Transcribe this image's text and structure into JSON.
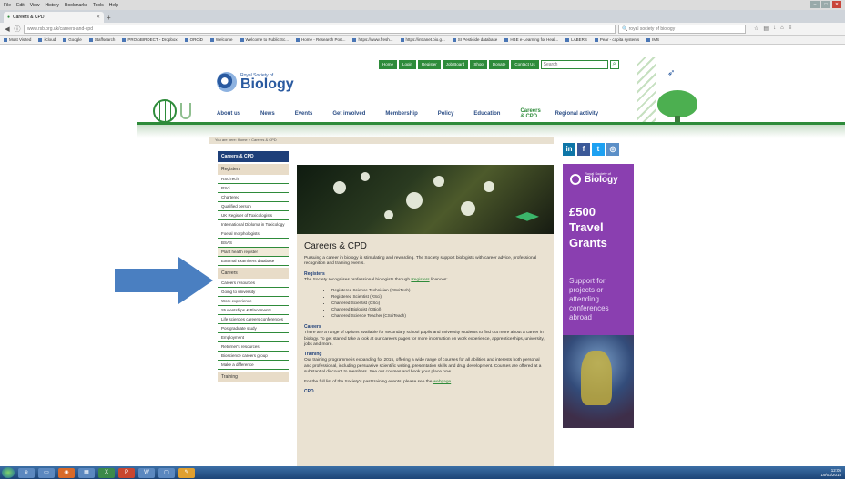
{
  "browser": {
    "menu": [
      "File",
      "Edit",
      "View",
      "History",
      "Bookmarks",
      "Tools",
      "Help"
    ],
    "tab_title": "Careers & CPD",
    "url": "www.rsb.org.uk/careers-and-cpd",
    "search": "royal society of biology",
    "bookmarks": [
      "Most Visited",
      "iCloud",
      "Google",
      "Staffsearch",
      "PROtoBIRDECT - Dropbox",
      "ORCiD",
      "Welcome",
      "Welcome to Public Sc...",
      "Home - Research Port...",
      "https://www.fresh...",
      "https://intranet.bio.g...",
      "SI Pesticide database",
      "HBE e-Learning for Heal...",
      "LABERS",
      "Pear - capita systems",
      "IMS"
    ]
  },
  "site": {
    "top_buttons": [
      "Home",
      "Login",
      "Register",
      "Job Board",
      "Shop",
      "Donate",
      "Contact Us"
    ],
    "search_placeholder": "Search",
    "logo_small": "Royal Society of",
    "logo_big": "Biology",
    "nav": [
      "About us",
      "News",
      "Events",
      "Get involved",
      "Membership",
      "Policy",
      "Education",
      "Careers & CPD",
      "Regional activity"
    ],
    "breadcrumb": "You are here:   Home  »  Careers & CPD"
  },
  "sidebar": {
    "header": "Careers & CPD",
    "sections": [
      {
        "title": "Registers",
        "items": [
          "RSciTech",
          "RSci",
          "Chartered",
          "Qualified person",
          "UK Register of Toxicologists",
          "International Diploma in Toxicology",
          "Foetal morphologists",
          "BSAS",
          "Plant health register",
          "External examiners database"
        ]
      },
      {
        "title": "Careers",
        "items": [
          "Careers resources",
          "Going to university",
          "Work experience",
          "Studentships & Placements",
          "Life sciences careers conferences",
          "Postgraduate study",
          "Employment",
          "Returner's resources",
          "Bioscience careers group",
          "Make a difference"
        ]
      },
      {
        "title": "Training",
        "items": []
      }
    ]
  },
  "content": {
    "title": "Careers & CPD",
    "intro": "Pursuing a career in biology is stimulating and rewarding. The Society support biologists with career advice, professional recognition and training events.",
    "registers_heading": "Registers",
    "registers_text_pre": "The Society recognises professional biologists through",
    "registers_link": "Registers",
    "registers_text_post": "licences:",
    "register_list": [
      "Registered Science Technician (RSciTech)",
      "Registered Scientist (RSci)",
      "Chartered Scientist (CSci)",
      "Chartered Biologist (CBiol)",
      "Chartered Science Teacher (CSciTeach)"
    ],
    "careers_heading": "Careers",
    "careers_text": "There are a range of options available for secondary school pupils and university students to find out more about a career in biology. To get started take a look at our careers pages for more information on work experience, apprenticeships, university, jobs and more.",
    "training_heading": "Training",
    "training_text": "Our training programme is expanding for 2015, offering a wide range of courses for all abilities and interests both personal and professional, including persuasive scientific writing, presentation skills and drug development. Courses are offered at a substantial discount to members. See our courses and book your place now.",
    "training_footer_pre": "For the full list of the Society's past training events, please see the",
    "training_footer_link": "webpage",
    "cpd_heading": "CPD"
  },
  "ad": {
    "logo_small": "Royal Society of",
    "logo_big": "Biology",
    "headline": "£500 Travel Grants",
    "blurb": "Support for projects or attending conferences abroad"
  },
  "social": {
    "icons": [
      "in",
      "f",
      "t",
      "rss"
    ],
    "colors": [
      "#0e76a8",
      "#3b5998",
      "#1da1f2",
      "#5b8fc7"
    ]
  },
  "taskbar": {
    "time": "12:05",
    "date": "19/03/2015"
  },
  "colors": {
    "green": "#2e8b3a",
    "navy": "#1e3f79",
    "purple": "#8a3fb0",
    "arrow": "#4a7fc1"
  }
}
